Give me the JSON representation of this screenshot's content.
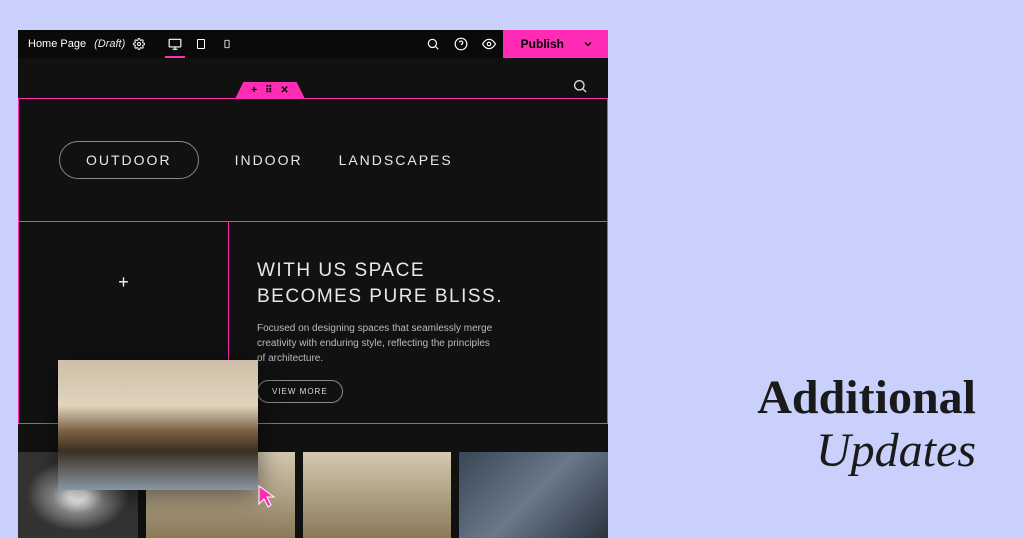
{
  "colors": {
    "accent": "#ff2db5",
    "canvas_bg": "#111111",
    "page_bg": "#c8d0fb"
  },
  "toolbar": {
    "page_title": "Home Page",
    "page_status": "(Draft)",
    "devices": [
      "desktop",
      "tablet",
      "mobile"
    ],
    "active_device": "desktop",
    "publish_label": "Publish"
  },
  "canvas": {
    "nav_tabs": [
      {
        "label": "OUTDOOR",
        "active": true
      },
      {
        "label": "INDOOR",
        "active": false
      },
      {
        "label": "LANDSCAPES",
        "active": false
      }
    ],
    "hero": {
      "headline_line1": "WITH US SPACE",
      "headline_line2": "BECOMES PURE BLISS.",
      "body": "Focused on designing spaces that seamlessly merge creativity with enduring style, reflecting the principles of architecture.",
      "cta_label": "VIEW MORE"
    },
    "section_handle_icons": [
      "plus",
      "drag",
      "close"
    ]
  },
  "overlay_headline": {
    "line1": "Additional",
    "line2": "Updates"
  }
}
